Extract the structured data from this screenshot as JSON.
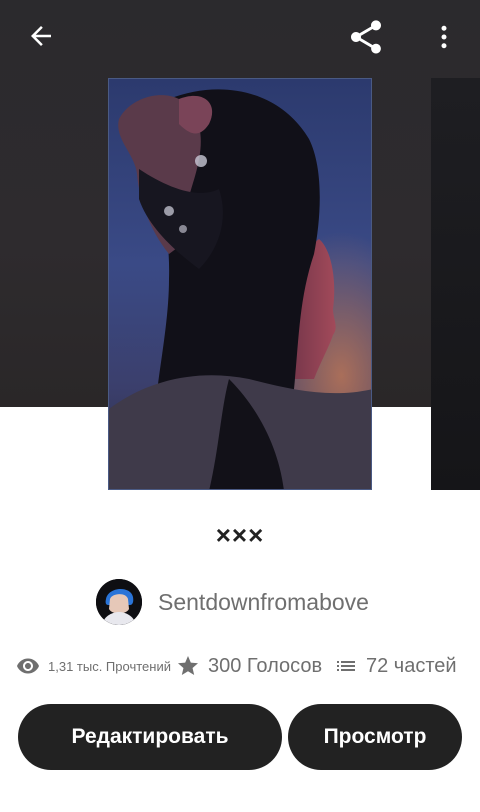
{
  "header": {
    "back_icon": "arrow-left-icon",
    "share_icon": "share-icon",
    "more_icon": "more-vertical-icon"
  },
  "story": {
    "title": "×××",
    "cover_alt": "portrait of a girl with dark hair in blue and red light",
    "author": "Sentdownfromabove"
  },
  "stats": {
    "reads": "1,31 тыс. Прочтений",
    "votes": "300 Голосов",
    "parts": "72 частей"
  },
  "actions": {
    "edit_label": "Редактировать",
    "view_label": "Просмотр"
  },
  "colors": {
    "hero_bg": "#2c2a2d",
    "button_bg": "#222222",
    "text_muted": "#6f6f6f"
  }
}
